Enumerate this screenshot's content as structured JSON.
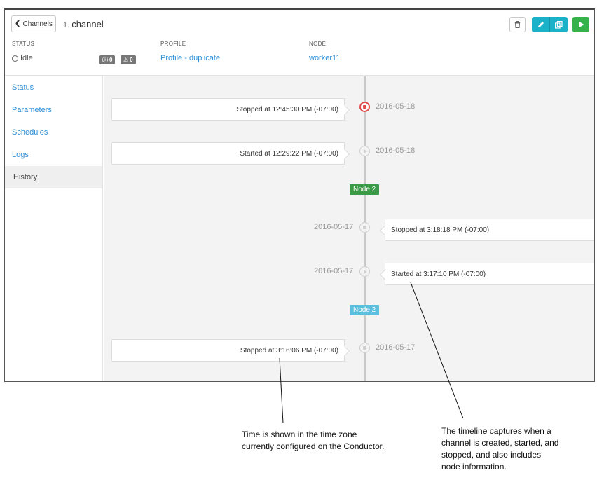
{
  "header": {
    "back_label": "Channels",
    "channel_number": "1.",
    "channel_name": "channel",
    "status_label": "STATUS",
    "status_value": "Idle",
    "error_count": "0",
    "warning_count": "0",
    "profile_label": "PROFILE",
    "profile_value": "Profile - duplicate",
    "node_label": "NODE",
    "node_value": "worker11"
  },
  "sidebar": {
    "items": [
      {
        "label": "Status"
      },
      {
        "label": "Parameters"
      },
      {
        "label": "Schedules"
      },
      {
        "label": "Logs"
      },
      {
        "label": "History"
      }
    ]
  },
  "timeline": {
    "events": [
      {
        "text": "Stopped at 12:45:30 PM (-07:00)",
        "date": "2016-05-18",
        "kind": "stop"
      },
      {
        "text": "Started at 12:29:22 PM (-07:00)",
        "date": "2016-05-18",
        "kind": "start"
      },
      {
        "text": "Stopped at 3:18:18 PM (-07:00)",
        "date": "2016-05-17",
        "kind": "stop"
      },
      {
        "text": "Started at 3:17:10 PM (-07:00)",
        "date": "2016-05-17",
        "kind": "start"
      },
      {
        "text": "Stopped at 3:16:06 PM (-07:00)",
        "date": "2016-05-17",
        "kind": "stop"
      }
    ],
    "node_tags": [
      {
        "label": "Node 2",
        "color": "#3a9a48"
      },
      {
        "label": "Node 2",
        "color": "#5bc0de"
      }
    ]
  },
  "annotations": {
    "timezone_note": [
      "Time is shown in the time zone",
      "currently configured on the Conductor."
    ],
    "timeline_note": [
      "The timeline captures when a",
      "channel is created, started, and",
      "stopped, and also includes",
      "node information."
    ]
  },
  "colors": {
    "link": "#2e8fd6",
    "teal_button": "#1bb1c9",
    "run_button": "#35b34a",
    "stop_marker": "#e24b4b"
  },
  "icons": {
    "back": "chevron-left-icon",
    "trash": "trash-icon",
    "edit": "pencil-icon",
    "copy": "duplicate-icon",
    "run": "play-icon",
    "error": "error-icon",
    "warning": "warning-icon"
  }
}
